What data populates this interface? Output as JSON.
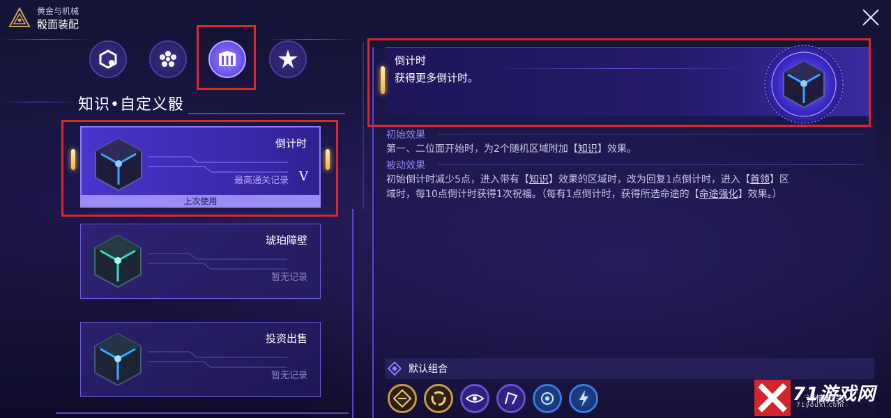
{
  "header": {
    "game_name": "黄金与机械",
    "page_title": "骰面装配"
  },
  "tabs": [
    {
      "icon": "hexagon-link-icon",
      "active": false
    },
    {
      "icon": "flower-dots-icon",
      "active": false
    },
    {
      "icon": "pillars-icon",
      "active": true
    },
    {
      "icon": "star-burst-icon",
      "active": false
    }
  ],
  "section_title": "知识•自定义骰",
  "cards": [
    {
      "name": "倒计时",
      "record": "最高通关记录",
      "grade": "V",
      "badge": "上次使用",
      "selected": true
    },
    {
      "name": "琥珀障壁",
      "record": "暂无记录",
      "selected": false
    },
    {
      "name": "投资出售",
      "record": "暂无记录",
      "selected": false
    }
  ],
  "detail": {
    "name": "倒计时",
    "description": "获得更多倒计时。",
    "initial_title": "初始效果",
    "initial_text_a": "第一、二位面开始时，为2个随机区域附加【",
    "initial_kw": "知识",
    "initial_text_b": "】效果。",
    "passive_title": "被动效果",
    "passive_l1_a": "初始倒计时减少5点，进入带有【",
    "passive_l1_kw1": "知识",
    "passive_l1_b": "】效果的区域时，改为回复1点倒计时，进入【",
    "passive_l1_kw2": "首领",
    "passive_l1_c": "】区",
    "passive_l2_a": "域时，每10点倒计时获得1次祝福。（每有1点倒计时，获得所选命途的【",
    "passive_l2_kw": "命途强化",
    "passive_l2_b": "】效果。）"
  },
  "combo": {
    "label": "默认组合",
    "details_label": "详情列表",
    "slots": [
      {
        "icon": "diamond-grid-icon",
        "color": "#c79a4a"
      },
      {
        "icon": "swirl-icon",
        "color": "#c79a4a"
      },
      {
        "icon": "eye-icon",
        "color": "#6a4fd8"
      },
      {
        "icon": "rune-icon",
        "color": "#6a4fd8"
      },
      {
        "icon": "flower-icon",
        "color": "#3a7ae0"
      },
      {
        "icon": "lightning-icon",
        "color": "#3a7ae0"
      }
    ]
  },
  "watermark": {
    "main": "71游戏网",
    "sub": "71youxi.com"
  },
  "colors": {
    "accent": "#6f55f0",
    "highlight": "#e0262c",
    "gold": "#f3c24b"
  }
}
